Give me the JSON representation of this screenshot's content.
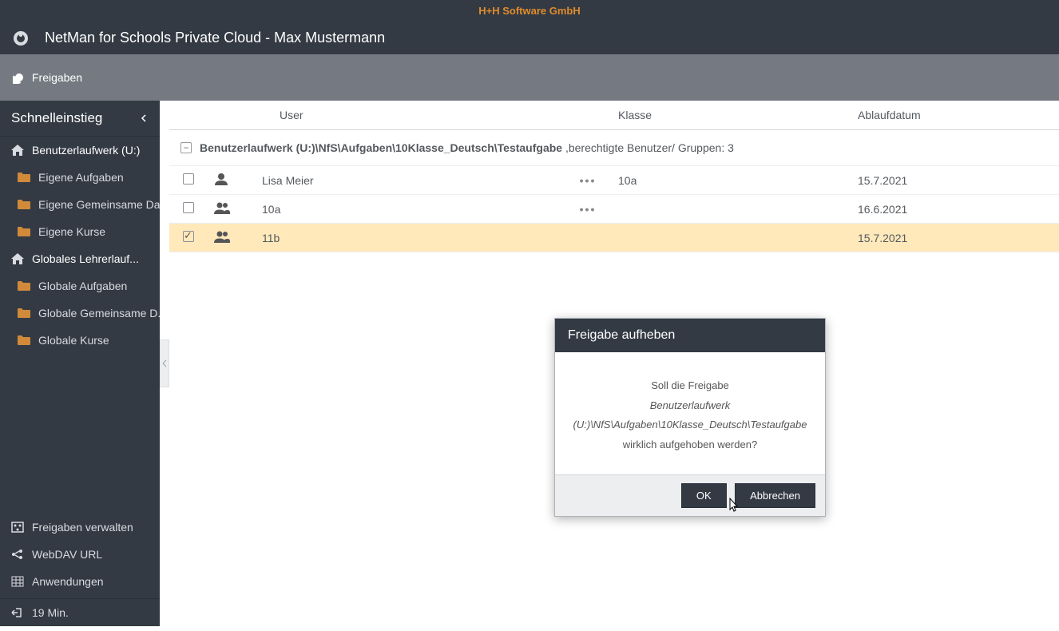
{
  "company": "H+H Software GmbH",
  "app_title": "NetMan for Schools Private Cloud - Max Mustermann",
  "toolbar": {
    "freigaben": "Freigaben"
  },
  "sidebar": {
    "header": "Schnelleinstieg",
    "root1": "Benutzerlaufwerk (U:)",
    "items1": [
      "Eigene Aufgaben",
      "Eigene Gemeinsame Da...",
      "Eigene Kurse"
    ],
    "root2": "Globales Lehrerlauf...",
    "items2": [
      "Globale Aufgaben",
      "Globale Gemeinsame D...",
      "Globale Kurse"
    ],
    "lower": {
      "freigaben": "Freigaben verwalten",
      "webdav": "WebDAV URL",
      "apps": "Anwendungen",
      "logout": "19 Min."
    }
  },
  "table": {
    "headers": {
      "user": "User",
      "klasse": "Klasse",
      "date": "Ablaufdatum"
    },
    "group": {
      "path": "Benutzerlaufwerk (U:)\\NfS\\Aufgaben\\10Klasse_Deutsch\\Testaufgabe",
      "suffix": ",berechtigte Benutzer/ Gruppen: 3"
    },
    "rows": [
      {
        "checked": false,
        "type": "user",
        "user": "Lisa Meier",
        "klasse": "10a",
        "date": "15.7.2021",
        "actions": true
      },
      {
        "checked": false,
        "type": "group",
        "user": "10a",
        "klasse": "",
        "date": "16.6.2021",
        "actions": true
      },
      {
        "checked": true,
        "type": "group",
        "user": "11b",
        "klasse": "",
        "date": "15.7.2021",
        "actions": false,
        "selected": true
      }
    ]
  },
  "modal": {
    "title": "Freigabe aufheben",
    "line1": "Soll die Freigabe",
    "line2": "Benutzerlaufwerk (U:)\\NfS\\Aufgaben\\10Klasse_Deutsch\\Testaufgabe",
    "line3": "wirklich aufgehoben werden?",
    "ok": "OK",
    "cancel": "Abbrechen"
  }
}
